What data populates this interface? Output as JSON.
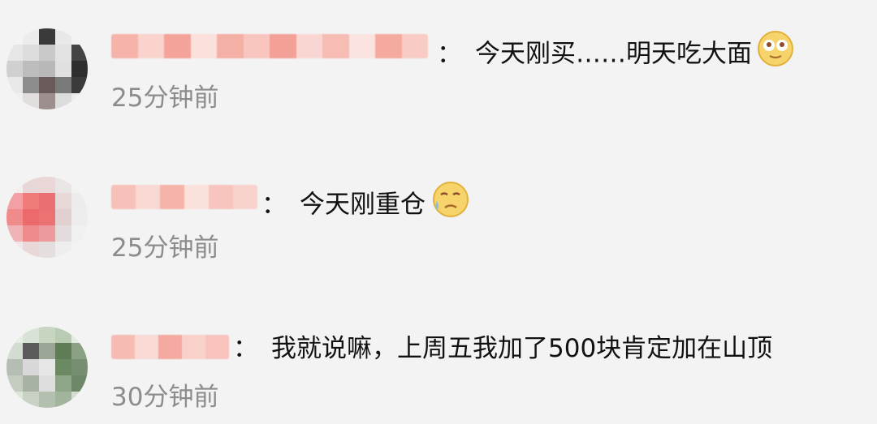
{
  "comments": [
    {
      "separator": "：",
      "text": "今天刚买……明天吃大面",
      "time": "25分钟前",
      "emoji": "dizzy-eyes-emoji"
    },
    {
      "separator": "：",
      "text": "今天刚重仓",
      "time": "25分钟前",
      "emoji": "crying-emoji"
    },
    {
      "separator": "：",
      "text": "我就说嘛，上周五我加了500块肯定加在山顶",
      "time": "30分钟前",
      "emoji": null
    }
  ]
}
